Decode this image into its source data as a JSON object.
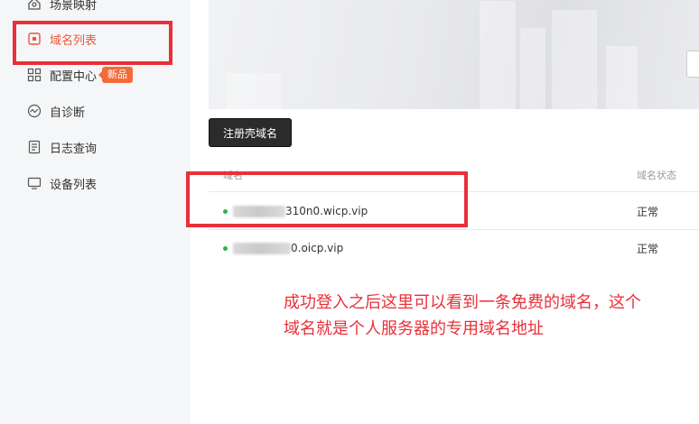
{
  "sidebar": {
    "items": [
      {
        "label": "场景映射",
        "icon": "scene-map-icon"
      },
      {
        "label": "域名列表",
        "icon": "domain-list-icon",
        "active": true
      },
      {
        "label": "配置中心",
        "icon": "config-grid-icon",
        "badge": "新品"
      },
      {
        "label": "自诊断",
        "icon": "diagnose-icon"
      },
      {
        "label": "日志查询",
        "icon": "log-icon"
      },
      {
        "label": "设备列表",
        "icon": "device-icon"
      }
    ]
  },
  "main": {
    "register_button": "注册壳域名",
    "table": {
      "headers": [
        "域名",
        "域名状态"
      ],
      "rows": [
        {
          "domain_visible": "310n0.wicp.vip",
          "status": "正常"
        },
        {
          "domain_visible": "0.oicp.vip",
          "status": "正常"
        }
      ]
    }
  },
  "annotation": {
    "line1": "成功登入之后这里可以看到一条免费的域名，这个",
    "line2": "域名就是个人服务器的专用域名地址"
  },
  "colors": {
    "accent": "#e9573d",
    "annotation_red": "#e8303a",
    "status_green": "#2fb344",
    "badge": "#f26b3a"
  }
}
